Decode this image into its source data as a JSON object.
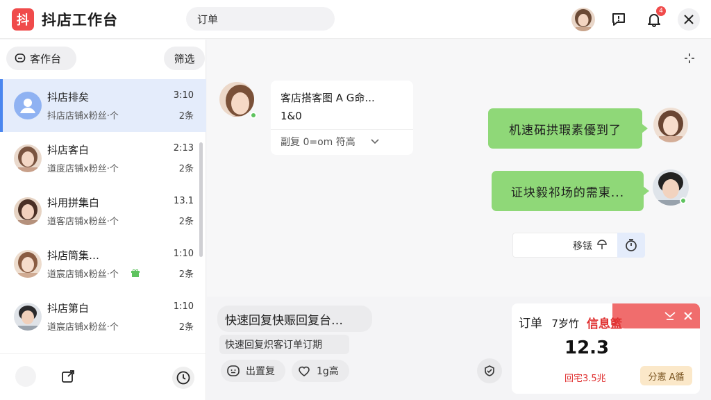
{
  "header": {
    "logo_text": "抖",
    "app_title": "抖店工作台",
    "search_value": "订单",
    "notification_count": "4"
  },
  "sidebar": {
    "workspace_label": "客作台",
    "filter_label": "筛选",
    "conversations": [
      {
        "name": "抖店排矣",
        "preview": "抖店店铺x粉丝·个",
        "time": "3:10",
        "count": "2条",
        "active": true
      },
      {
        "name": "抖店客白",
        "preview": "道度店铺x粉丝·个",
        "time": "2:13",
        "count": "2条",
        "active": false
      },
      {
        "name": "抖用拼集白",
        "preview": "道客店铺x粉丝·个",
        "time": "13.1",
        "count": "2条",
        "active": false
      },
      {
        "name": "抖店筒集…",
        "preview": "道宸店铺x粉丝·个",
        "time": "1:10",
        "count": "2条",
        "active": false
      },
      {
        "name": "抖店第白",
        "preview": "道宸店铺x粉丝·个",
        "time": "1:10",
        "count": "2条",
        "active": false
      }
    ]
  },
  "chat": {
    "card_title": "客店搭客图 A G命...",
    "card_number": "1&0",
    "card_footer": "副复 0=om 符高",
    "bubble1": "机速砳拱瑕素優到了",
    "bubble2": "证块毅祁场的需東...",
    "status_text": "移铥"
  },
  "bottom": {
    "quick_title": "快速回复快赈回复台…",
    "quick_sub": "快速回复炽客订单订期",
    "btn_reply": "出置复",
    "btn_like": "1g高",
    "order_label": "订单",
    "order_sub": "7岁竹",
    "order_red": "信息籃",
    "order_value": "12.3",
    "order_note": "回宅3.5兆",
    "order_action": "分憲 A循"
  },
  "colors": {
    "brand": "#f04b4b",
    "accent_blue": "#4a86ef",
    "bubble_green": "#8fd878",
    "online_green": "#5ec35e"
  }
}
